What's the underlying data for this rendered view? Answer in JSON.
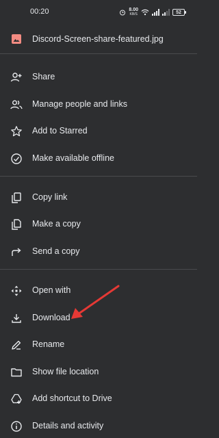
{
  "status_bar": {
    "time": "00:20",
    "net_speed_value": "8.00",
    "net_speed_unit": "KB/S",
    "battery": "52"
  },
  "file": {
    "name": "Discord-Screen-share-featured.jpg",
    "icon": "image-icon",
    "icon_color": "#f28b82"
  },
  "menu": {
    "share": "Share",
    "manage_people": "Manage people and links",
    "starred": "Add to Starred",
    "offline": "Make available offline",
    "copy_link": "Copy link",
    "make_copy": "Make a copy",
    "send_copy": "Send a copy",
    "open_with": "Open with",
    "download": "Download",
    "rename": "Rename",
    "show_location": "Show file location",
    "add_shortcut": "Add shortcut to Drive",
    "details": "Details and activity"
  },
  "colors": {
    "background": "#2d2e30",
    "text": "#e8eaed",
    "annotation_arrow": "#e53935"
  }
}
